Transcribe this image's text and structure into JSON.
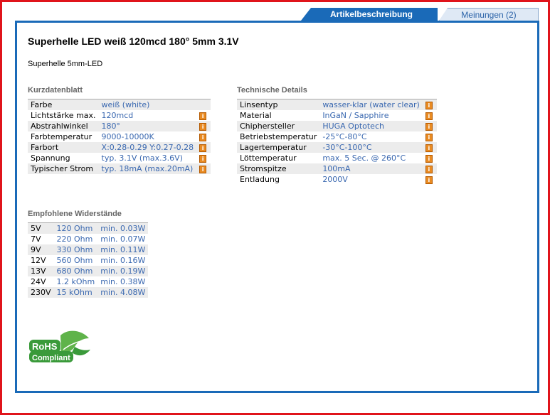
{
  "tabs": {
    "active": "Artikelbeschreibung",
    "inactive": "Meinungen (2)"
  },
  "product": {
    "title": "Superhelle LED weiß 120mcd 180° 5mm 3.1V",
    "subtitle": "Superhelle 5mm-LED"
  },
  "kurz": {
    "heading": "Kurzdatenblatt",
    "rows": [
      {
        "label": "Farbe",
        "value": "weiß (white)",
        "icon": false
      },
      {
        "label": "Lichtstärke max.",
        "value": "120mcd",
        "icon": true
      },
      {
        "label": "Abstrahlwinkel",
        "value": "180°",
        "icon": true
      },
      {
        "label": "Farbtemperatur",
        "value": "9000-10000K",
        "icon": true
      },
      {
        "label": "Farbort",
        "value": "X:0.28-0.29 Y:0.27-0.28",
        "icon": true
      },
      {
        "label": "Spannung",
        "value": "typ. 3.1V (max.3.6V)",
        "icon": true
      },
      {
        "label": "Typischer Strom",
        "value": "typ. 18mA (max.20mA)",
        "icon": true
      }
    ]
  },
  "tech": {
    "heading": "Technische Details",
    "rows": [
      {
        "label": "Linsentyp",
        "value": "wasser-klar (water clear)",
        "icon": true
      },
      {
        "label": "Material",
        "value": "InGaN / Sapphire",
        "icon": true
      },
      {
        "label": "Chiphersteller",
        "value": "HUGA Optotech",
        "icon": true
      },
      {
        "label": "Betriebstemperatur",
        "value": "-25°C-80°C",
        "icon": true
      },
      {
        "label": "Lagertemperatur",
        "value": "-30°C-100°C",
        "icon": true
      },
      {
        "label": "Löttemperatur",
        "value": "max. 5 Sec. @ 260°C",
        "icon": true
      },
      {
        "label": "Stromspitze",
        "value": "100mA",
        "icon": true
      },
      {
        "label": "Entladung",
        "value": "2000V",
        "icon": true
      }
    ]
  },
  "widerstaende": {
    "heading": "Empfohlene Widerstände",
    "rows": [
      {
        "voltage": "5V",
        "resistor": "120 Ohm",
        "power": "min. 0.03W"
      },
      {
        "voltage": "7V",
        "resistor": "220 Ohm",
        "power": "min. 0.07W"
      },
      {
        "voltage": "9V",
        "resistor": "330 Ohm",
        "power": "min. 0.11W"
      },
      {
        "voltage": "12V",
        "resistor": "560 Ohm",
        "power": "min. 0.16W"
      },
      {
        "voltage": "13V",
        "resistor": "680 Ohm",
        "power": "min. 0.19W"
      },
      {
        "voltage": "24V",
        "resistor": "1.2 kOhm",
        "power": "min. 0.38W"
      },
      {
        "voltage": "230V",
        "resistor": "15 kOhm",
        "power": "min. 4.08W"
      }
    ]
  },
  "rohs": {
    "line1": "RoHS",
    "line2": "Compliant"
  },
  "icons": {
    "info": "info-icon",
    "rohs_leaf": "leaf-icon"
  },
  "colors": {
    "frame": "#e0141b",
    "accent": "#1a6ab8",
    "value_text": "#3a68b0",
    "info_icon": "#e88a22",
    "rohs_green": "#3a9a3a"
  }
}
